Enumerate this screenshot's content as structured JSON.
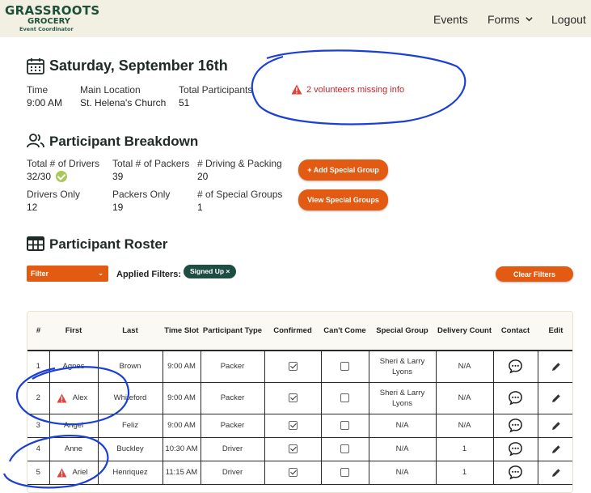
{
  "brand": {
    "line1": "GRASSROOTS",
    "line2": "GROCERY",
    "line3": "Event Coordinator"
  },
  "nav": {
    "events": "Events",
    "forms": "Forms",
    "logout": "Logout"
  },
  "event": {
    "title": "Saturday, September 16th",
    "time_label": "Time",
    "time_value": "9:00 AM",
    "location_label": "Main Location",
    "location_value": "St. Helena's Church",
    "participants_label": "Total Participants",
    "participants_value": "51",
    "alert": "2 volunteers missing info"
  },
  "breakdown": {
    "title": "Participant Breakdown",
    "drivers_label": "Total # of Drivers",
    "drivers_value": "32/30",
    "packers_label": "Total # of Packers",
    "packers_value": "39",
    "driving_packing_label": "# Driving & Packing",
    "driving_packing_value": "20",
    "drivers_only_label": "Drivers Only",
    "drivers_only_value": "12",
    "packers_only_label": "Packers Only",
    "packers_only_value": "19",
    "special_groups_label": "# of Special Groups",
    "special_groups_value": "1",
    "add_group_button": "+ Add Special Group",
    "view_groups_button": "View Special Groups"
  },
  "roster": {
    "title": "Participant Roster",
    "filter_label": "Filter",
    "applied_label": "Applied Filters:",
    "chip_label": "Signed Up ×",
    "clear_button": "Clear Filters",
    "columns": [
      "#",
      "First",
      "Last",
      "Time Slot",
      "Participant Type",
      "Confirmed",
      "Can't Come",
      "Special Group",
      "Delivery Count",
      "Contact",
      "Edit"
    ],
    "rows": [
      {
        "num": "1",
        "first": "Agnes",
        "last": "Brown",
        "slot": "9:00 AM",
        "type": "Packer",
        "group": "Sheri & Larry Lyons",
        "delivery": "N/A"
      },
      {
        "num": "2",
        "first": "Alex",
        "last": "Whiteford",
        "slot": "9:00 AM",
        "type": "Packer",
        "group": "Sheri & Larry Lyons",
        "delivery": "N/A"
      },
      {
        "num": "3",
        "first": "Angel",
        "last": "Feliz",
        "slot": "9:00 AM",
        "type": "Packer",
        "group": "N/A",
        "delivery": "N/A"
      },
      {
        "num": "4",
        "first": "Anne",
        "last": "Buckley",
        "slot": "10:30 AM",
        "type": "Driver",
        "group": "N/A",
        "delivery": "1"
      },
      {
        "num": "5",
        "first": "Ariel",
        "last": "Henriquez",
        "slot": "11:15 AM",
        "type": "Driver",
        "group": "N/A",
        "delivery": "1"
      }
    ]
  },
  "colors": {
    "accent": "#e35b12",
    "brand": "#1f4f3a",
    "alert": "#c0282b",
    "annotation": "#1a3fd6"
  }
}
